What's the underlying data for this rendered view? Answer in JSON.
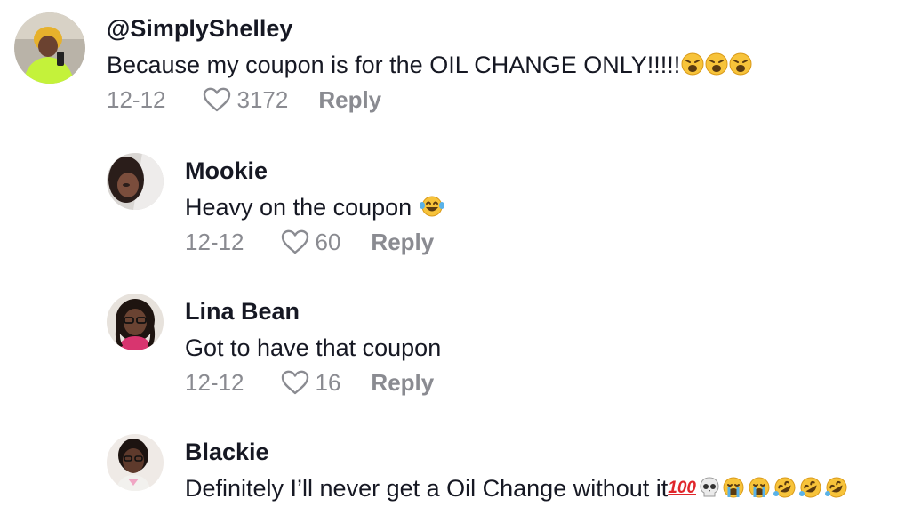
{
  "comments": [
    {
      "username": "@SimplyShelley",
      "text": "Because my coupon is for the OIL CHANGE ONLY!!!!!",
      "emojis": [
        "weary-face",
        "weary-face",
        "weary-face"
      ],
      "date": "12-12",
      "likes": "3172",
      "reply_label": "Reply"
    },
    {
      "username": "Mookie",
      "text": "Heavy on the coupon ",
      "emojis": [
        "face-with-tears-of-joy"
      ],
      "date": "12-12",
      "likes": "60",
      "reply_label": "Reply"
    },
    {
      "username": "Lina Bean",
      "text": "Got to have that coupon",
      "emojis": [],
      "date": "12-12",
      "likes": "16",
      "reply_label": "Reply"
    },
    {
      "username": "Blackie",
      "text": "Definitely I’ll never get a Oil Change without it",
      "hundred_mark": "100",
      "emojis": [
        "hundred-points",
        "skull",
        "loudly-crying-face",
        "loudly-crying-face",
        "rolling-on-floor-laughing",
        "rolling-on-floor-laughing",
        "rolling-on-floor-laughing"
      ]
    }
  ],
  "colors": {
    "text": "#161823",
    "meta": "#8a8b91",
    "emoji_yellow": "#f7c33a"
  }
}
